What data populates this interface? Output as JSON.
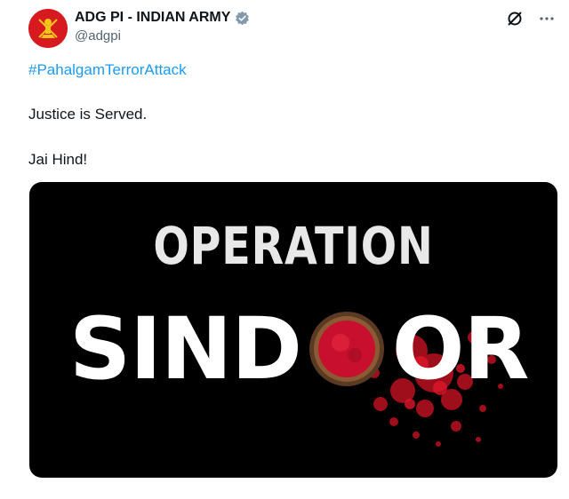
{
  "author": {
    "display_name": "ADG PI - INDIAN ARMY",
    "handle": "@adgpi"
  },
  "actions": {
    "grok_icon": "grok-icon",
    "more_icon": "more-icon",
    "more_label": "···"
  },
  "tweet": {
    "hashtag": "#PahalgamTerrorAttack",
    "line1": "Justice is Served.",
    "line2": "Jai Hind!"
  },
  "media": {
    "line_top": "OPERATION",
    "word_left": "SIND",
    "word_right": "OR"
  },
  "colors": {
    "link": "#1d9bf0",
    "verified": "#829aab",
    "brand_red": "#d71920",
    "sindoor_red": "#c8102e"
  }
}
